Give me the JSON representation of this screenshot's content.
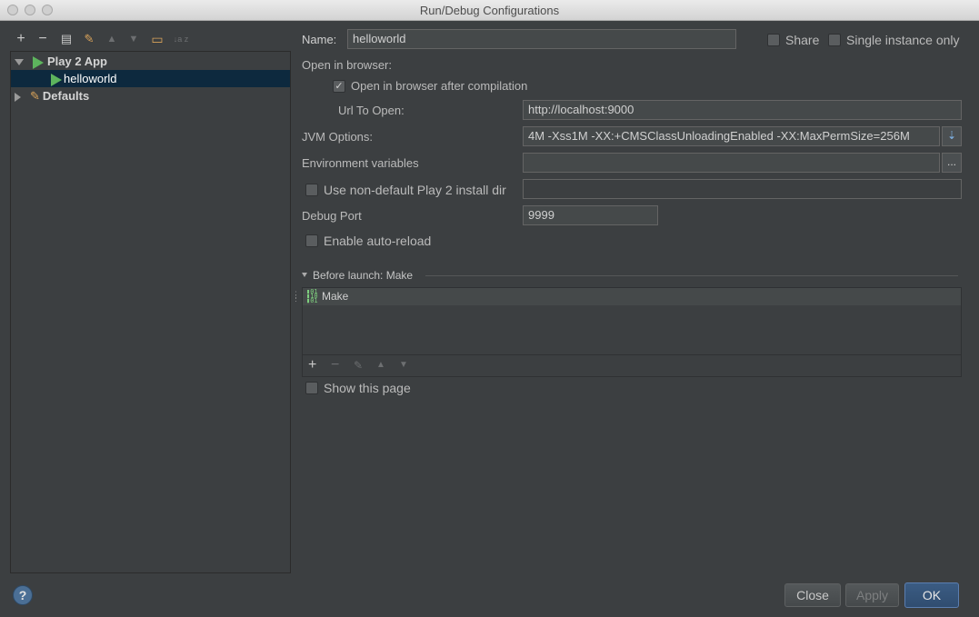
{
  "window": {
    "title": "Run/Debug Configurations"
  },
  "toolbar": {
    "add": "+",
    "remove": "−",
    "copy": "▤",
    "edit_defaults": "✎",
    "move_up": "▲",
    "move_down": "▼",
    "folder": "▭",
    "sort": "↓a z"
  },
  "tree": {
    "items": [
      {
        "label": "Play 2 App"
      },
      {
        "label": "helloworld"
      },
      {
        "label": "Defaults"
      }
    ]
  },
  "form": {
    "name_label": "Name:",
    "name_value": "helloworld",
    "share_label": "Share",
    "single_instance_label": "Single instance only",
    "open_in_browser_label": "Open in browser:",
    "open_after_compile_label": "Open in browser after compilation",
    "url_label": "Url To Open:",
    "url_value": "http://localhost:9000",
    "jvm_label": "JVM Options:",
    "jvm_value": "4M -Xss1M -XX:+CMSClassUnloadingEnabled -XX:MaxPermSize=256M",
    "env_label": "Environment variables",
    "env_value": "",
    "env_button": "...",
    "non_default_label": "Use non-default Play 2 install dir",
    "non_default_value": "",
    "debug_port_label": "Debug Port",
    "debug_port_value": "9999",
    "auto_reload_label": "Enable auto-reload"
  },
  "before_launch": {
    "header": "Before launch: Make",
    "items": [
      {
        "label": "Make"
      }
    ],
    "add": "+",
    "remove": "−",
    "edit": "✎",
    "up": "▲",
    "down": "▼",
    "show_page_label": "Show this page"
  },
  "footer": {
    "help": "?",
    "close": "Close",
    "apply": "Apply",
    "ok": "OK"
  },
  "colors": {
    "accent": "#0d293e",
    "play_green": "#5db45d"
  }
}
